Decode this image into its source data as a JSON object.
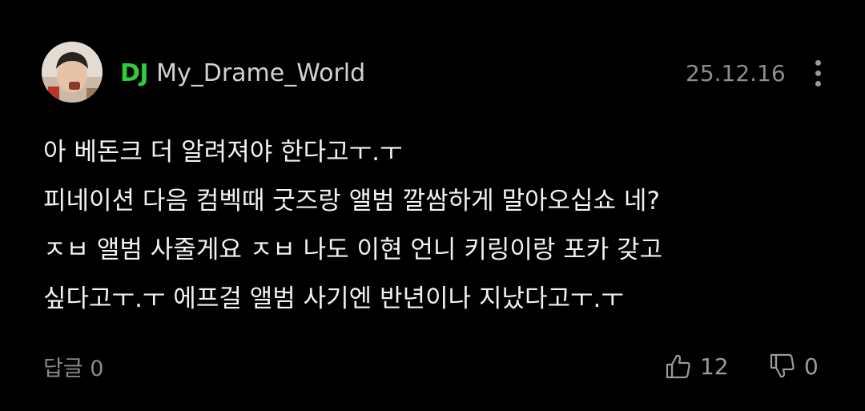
{
  "comment": {
    "avatar_icon": "profile-photo",
    "badge": "DJ",
    "badge_color": "#2ecc40",
    "username": "My_Drame_World",
    "date": "25.12.16",
    "more_icon": "vertical-ellipsis-icon",
    "lines": [
      "아 베돈크 더 알려져야 한다고ㅜ.ㅜ",
      "피네이션 다음 컴벡때 굿즈랑 앨범 깔쌈하게 말아오십쇼 네?",
      "ㅈㅂ 앨범 사줄게요 ㅈㅂ 나도 이현 언니 키링이랑 포카 갖고",
      "싶다고ㅜ.ㅜ 에프걸 앨범 사기엔 반년이나 지났다고ㅜ.ㅜ"
    ],
    "reply_label": "답글 0",
    "like_icon": "thumbs-up-icon",
    "like_count": "12",
    "dislike_icon": "thumbs-down-icon",
    "dislike_count": "0"
  }
}
